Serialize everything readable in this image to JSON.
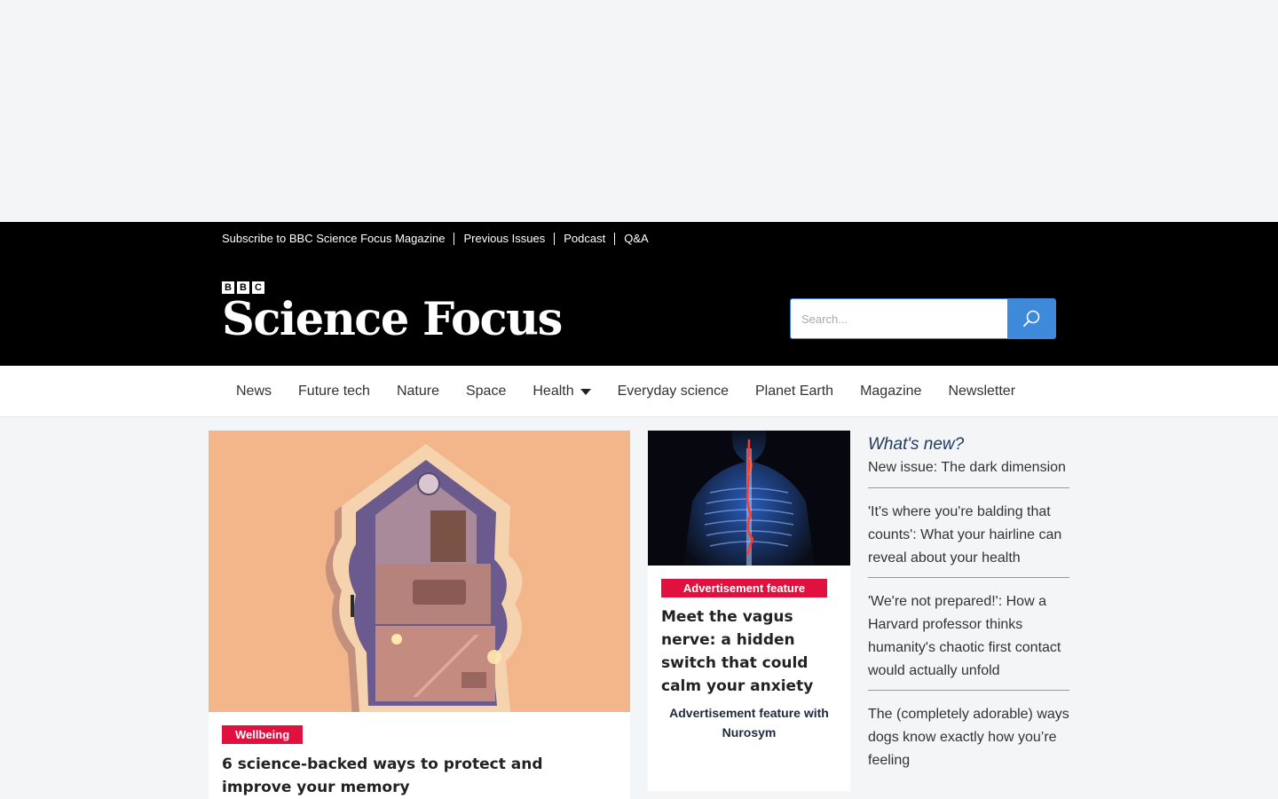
{
  "toplinks": [
    {
      "label": "Subscribe to BBC Science Focus Magazine"
    },
    {
      "label": "Previous Issues"
    },
    {
      "label": "Podcast"
    },
    {
      "label": "Q&A"
    }
  ],
  "logo": {
    "bbc_letters": [
      "B",
      "B",
      "C"
    ],
    "wordmark": "Science Focus"
  },
  "search": {
    "placeholder": "Search...",
    "icon": "search-icon"
  },
  "nav": [
    {
      "label": "News"
    },
    {
      "label": "Future tech"
    },
    {
      "label": "Nature"
    },
    {
      "label": "Space"
    },
    {
      "label": "Health",
      "has_dropdown": true
    },
    {
      "label": "Everyday science"
    },
    {
      "label": "Planet Earth"
    },
    {
      "label": "Magazine"
    },
    {
      "label": "Newsletter"
    }
  ],
  "main_article": {
    "tag": "Wellbeing",
    "title": "6 science-backed ways to protect and improve your memory"
  },
  "ad_article": {
    "tag": "Advertisement feature",
    "title": "Meet the vagus nerve: a hidden switch that could calm your anxiety",
    "sponsor": "Advertisement feature with Nurosym"
  },
  "whats_new": {
    "heading": "What's new?",
    "items": [
      {
        "label": "New issue: The dark dimension"
      },
      {
        "label": "'It's where you're balding that counts': What your hairline can reveal about your health"
      },
      {
        "label": "'We're not prepared!': How a Harvard professor thinks humanity's chaotic first contact would actually unfold"
      },
      {
        "label": "The (completely adorable) ways dogs know exactly how you’re feeling"
      }
    ]
  },
  "colors": {
    "accent_red": "#e0103f",
    "search_blue": "#3f89db",
    "masthead_bg": "#000000",
    "page_bg": "#f3f5f7"
  }
}
